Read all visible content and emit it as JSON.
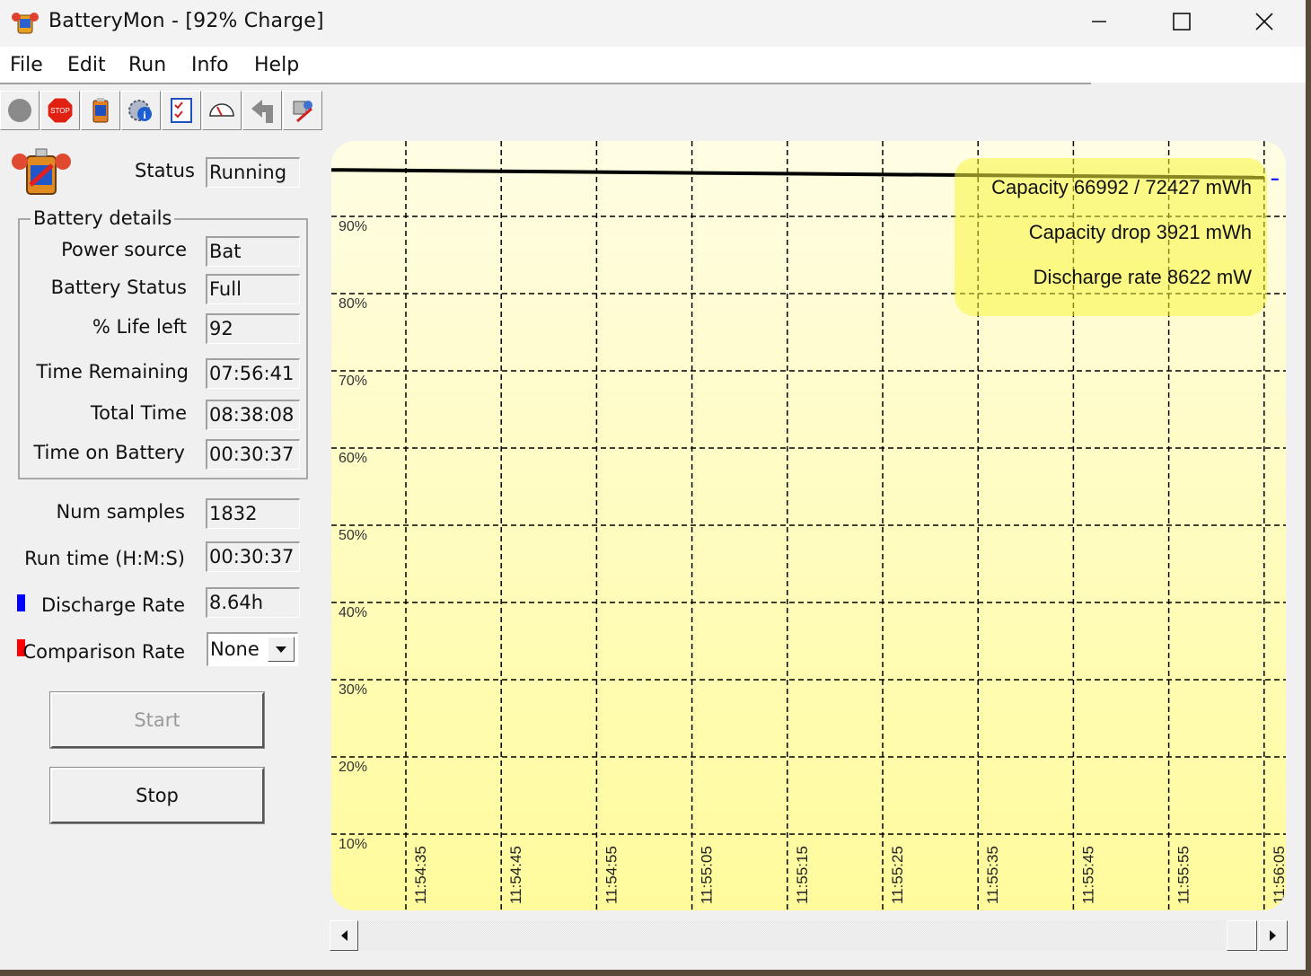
{
  "window": {
    "title": "BatteryMon - [92% Charge]",
    "controls": [
      "minimize",
      "maximize",
      "close"
    ]
  },
  "menu": [
    "File",
    "Edit",
    "Run",
    "Info",
    "Help"
  ],
  "toolbar": {
    "icons": [
      "record-icon",
      "stop-icon",
      "battery-icon",
      "settings-info-icon",
      "checklist-icon",
      "gauge-icon",
      "back-icon",
      "tools-icon"
    ]
  },
  "status": {
    "label": "Status",
    "value": "Running"
  },
  "battery_details": {
    "title": "Battery details",
    "fields": [
      {
        "label": "Power source",
        "value": "Bat"
      },
      {
        "label": "Battery Status",
        "value": "Full"
      },
      {
        "label": "% Life left",
        "value": "92"
      },
      {
        "label": "Time Remaining",
        "value": "07:56:41"
      },
      {
        "label": "Total Time",
        "value": "08:38:08"
      },
      {
        "label": "Time on Battery",
        "value": "00:30:37"
      }
    ]
  },
  "stats": [
    {
      "label": "Num samples",
      "value": "1832"
    },
    {
      "label": "Run time (H:M:S)",
      "value": "00:30:37"
    },
    {
      "label": "Discharge Rate",
      "value": "8.64h",
      "swatch": "#0000ff"
    },
    {
      "label": "Comparison Rate",
      "value": "None",
      "swatch": "#ff0000"
    }
  ],
  "buttons": {
    "start": "Start",
    "stop": "Stop"
  },
  "tooltip": [
    "Capacity 66992 / 72427 mWh",
    "Capacity drop 3921 mWh",
    "Discharge rate 8622 mW"
  ],
  "chart_data": {
    "type": "line",
    "y_tick_labels": [
      "90%",
      "80%",
      "70%",
      "60%",
      "50%",
      "40%",
      "30%",
      "20%",
      "10%"
    ],
    "x_tick_labels": [
      "11:54:35",
      "11:54:45",
      "11:54:55",
      "11:55:05",
      "11:55:15",
      "11:55:25",
      "11:55:35",
      "11:55:45",
      "11:55:55",
      "11:56:05"
    ],
    "grid": true,
    "series": [
      {
        "color": "#000000",
        "x": [
          "11:54:35",
          "11:56:05"
        ],
        "values": [
          93,
          92
        ]
      },
      {
        "color": "#0000ff",
        "x": [
          "11:56:05"
        ],
        "values": [
          92
        ]
      }
    ],
    "background": [
      "#fffde4",
      "#fffb9c"
    ]
  }
}
